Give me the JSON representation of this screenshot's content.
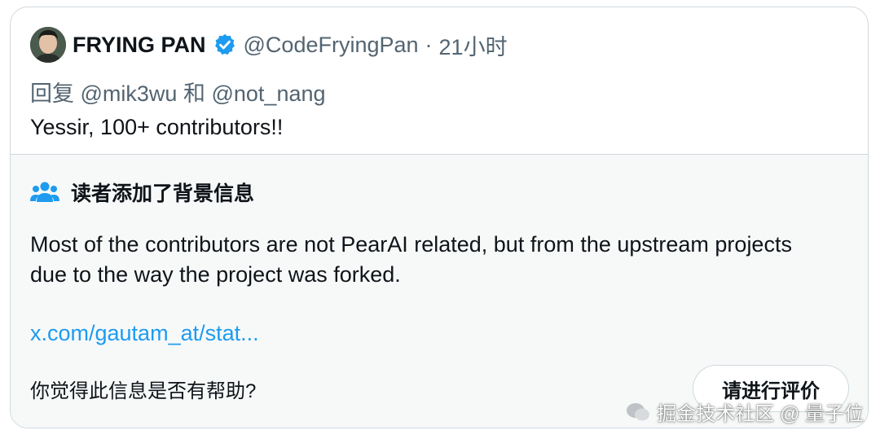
{
  "tweet": {
    "display_name": "FRYING PAN",
    "verified_icon": "verified-badge-icon",
    "handle": "@CodeFryingPan",
    "separator": "·",
    "time": "21小时",
    "reply_prefix": "回复",
    "reply_to_1": "@mik3wu",
    "reply_join": "和",
    "reply_to_2": "@not_nang",
    "text": "Yessir, 100+ contributors!!"
  },
  "community_note": {
    "icon": "people-icon",
    "title": "读者添加了背景信息",
    "body": "Most of the contributors are not PearAI related, but from the upstream projects due to the way the project was forked.",
    "link": "x.com/gautam_at/stat...",
    "helpful_question": "你觉得此信息是否有帮助?",
    "rate_button_label": "请进行评价"
  },
  "watermark": {
    "icon": "wechat-icon",
    "text": "掘金技术社区 @ 量子位"
  },
  "colors": {
    "accent_blue": "#1d9bf0",
    "secondary_text": "#536471",
    "border": "#cfd9de",
    "note_bg": "#f7f9f9"
  }
}
